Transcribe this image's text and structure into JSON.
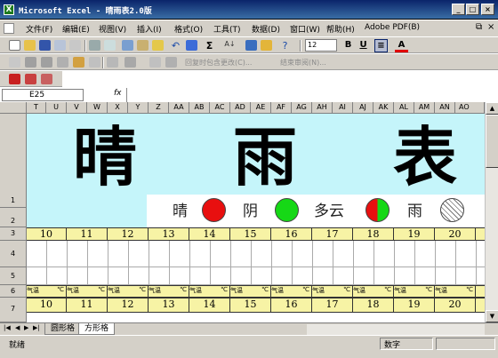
{
  "window": {
    "title": "Microsoft Excel - 晴雨表2.0版",
    "minimize": "_",
    "maximize": "□",
    "close": "×"
  },
  "menu": {
    "items": [
      "文件(F)",
      "编辑(E)",
      "视图(V)",
      "插入(I)",
      "格式(O)",
      "工具(T)",
      "数据(D)",
      "窗口(W)",
      "帮助(H)",
      "Adobe PDF(B)"
    ],
    "doc_restore": "⧉",
    "doc_close": "×"
  },
  "toolbar": {
    "font_size": "12",
    "bold": "B",
    "underline": "U",
    "font_color": "A",
    "sigma": "Σ",
    "reply_changes": "回复时包含更改(C)...",
    "end_review": "结束审阅(N)..."
  },
  "formula_bar": {
    "name_box": "E25",
    "fx": "fx",
    "value": ""
  },
  "columns": [
    "T",
    "U",
    "V",
    "W",
    "X",
    "Y",
    "Z",
    "AA",
    "AB",
    "AC",
    "AD",
    "AE",
    "AF",
    "AG",
    "AH",
    "AI",
    "AJ",
    "AK",
    "AL",
    "AM",
    "AN",
    "AO"
  ],
  "rows": [
    "1",
    "2",
    "3",
    "4",
    "5",
    "6",
    "7"
  ],
  "sheet": {
    "title_chars": [
      "晴",
      "雨",
      "表"
    ],
    "legend": [
      {
        "label": "晴",
        "color": "#e80f0f"
      },
      {
        "label": "阴",
        "color": "#16d816"
      },
      {
        "label": "多云",
        "color": "split"
      },
      {
        "label": "雨",
        "color": "hatch"
      }
    ],
    "dates_row3": [
      "10",
      "11",
      "12",
      "13",
      "14",
      "15",
      "16",
      "17",
      "18",
      "19",
      "20"
    ],
    "temp_label": "气温",
    "temp_unit": "℃",
    "dates_row7": [
      "10",
      "11",
      "12",
      "13",
      "14",
      "15",
      "16",
      "17",
      "18",
      "19",
      "20"
    ]
  },
  "tabs": {
    "items": [
      "圆形格",
      "方形格"
    ],
    "active": 1
  },
  "status": {
    "left": "就绪",
    "mode": "数字"
  }
}
